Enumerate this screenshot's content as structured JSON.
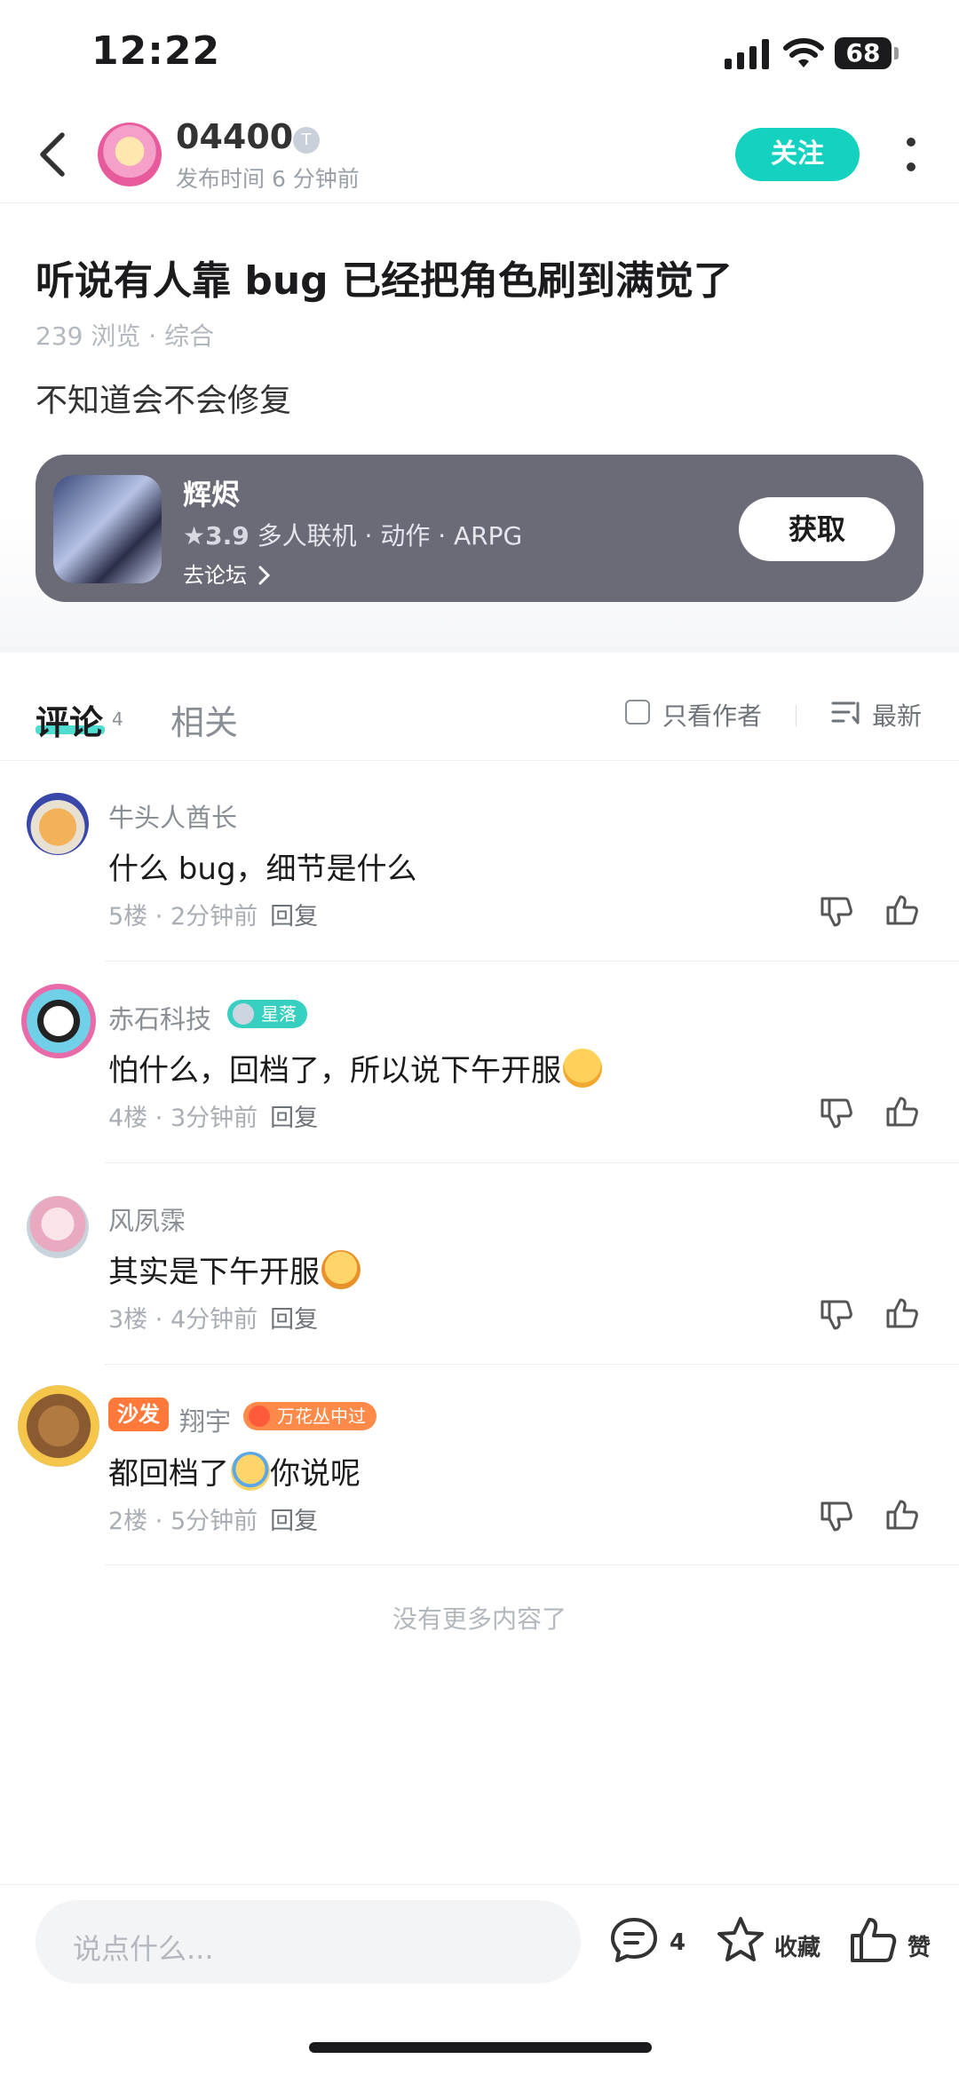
{
  "status_bar": {
    "time": "12:22",
    "battery": "68"
  },
  "header": {
    "author": "04400",
    "level_badge": "T",
    "post_time": "发布时间 6 分钟前",
    "follow_label": "关注"
  },
  "post": {
    "title": "听说有人靠 bug 已经把角色刷到满觉了",
    "views": "239 浏览",
    "separator": " · ",
    "category": "综合",
    "body": "不知道会不会修复"
  },
  "game": {
    "name": "辉烬",
    "rating": "3.9",
    "tags": "多人联机 · 动作 · ARPG",
    "forum_link": "去论坛",
    "get_label": "获取"
  },
  "tabs": {
    "comments_label": "评论",
    "comments_count": "4",
    "related_label": "相关",
    "author_only_label": "只看作者",
    "sort_label": "最新"
  },
  "comments": [
    {
      "user": "牛头人酋长",
      "text": "什么 bug，细节是什么",
      "floor": "5楼",
      "time": "2分钟前",
      "reply": "回复"
    },
    {
      "user": "赤石科技",
      "badge": "星落",
      "text": "怕什么，回档了，所以说下午开服",
      "floor": "4楼",
      "time": "3分钟前",
      "reply": "回复"
    },
    {
      "user": "风夙霂",
      "text": "其实是下午开服",
      "floor": "3楼",
      "time": "4分钟前",
      "reply": "回复"
    },
    {
      "user": "翔宇",
      "sofa": "沙发",
      "badge": "万花丛中过",
      "text_a": "都回档了",
      "text_b": "你说呢",
      "floor": "2楼",
      "time": "5分钟前",
      "reply": "回复"
    }
  ],
  "no_more": "没有更多内容了",
  "bottom_bar": {
    "input_placeholder": "说点什么...",
    "comment_count": "4",
    "collect_label": "收藏",
    "like_label": "赞"
  },
  "colors": {
    "accent": "#15d2c0",
    "card_bg": "#6b6b78",
    "sofa": "#ff7a3a"
  }
}
